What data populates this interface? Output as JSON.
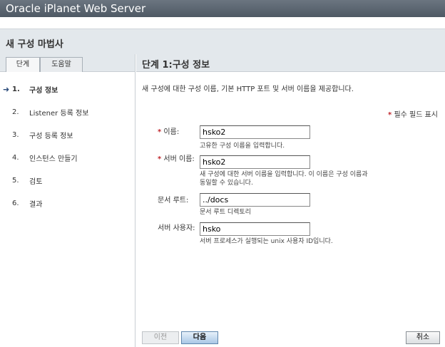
{
  "app_title": "Oracle iPlanet Web Server",
  "wizard_title": "새 구성 마법사",
  "tabs": [
    {
      "label": "단계"
    },
    {
      "label": "도움말"
    }
  ],
  "steps": [
    {
      "num": "1.",
      "label": "구성 정보"
    },
    {
      "num": "2.",
      "label": "Listener 등록 정보"
    },
    {
      "num": "3.",
      "label": "구성 등록 정보"
    },
    {
      "num": "4.",
      "label": "인스턴스 만들기"
    },
    {
      "num": "5.",
      "label": "검토"
    },
    {
      "num": "6.",
      "label": "결과"
    }
  ],
  "step_title": "단계 1:구성 정보",
  "description": "새 구성에 대한 구성 이름, 기본 HTTP 포트 및 서버 이름을 제공합니다.",
  "required_note": "필수 필드 표시",
  "required_mark": "*",
  "fields": [
    {
      "label": "이름:",
      "value": "hsko2",
      "help": "고유한 구성 이름을 입력합니다."
    },
    {
      "label": "서버 이름:",
      "value": "hsko2",
      "help": "새 구성에 대한 서버 이름을 입력합니다. 이 이름은 구성 이름과 동일할 수 있습니다."
    },
    {
      "label": "문서 루트:",
      "value": "../docs",
      "help": "문서 루트 디렉토리"
    },
    {
      "label": "서버 사용자:",
      "value": "hsko",
      "help": "서버 프로세스가 실행되는 unix 사용자 ID입니다."
    }
  ],
  "buttons": {
    "prev": "이전",
    "next": "다음",
    "cancel": "취소"
  }
}
